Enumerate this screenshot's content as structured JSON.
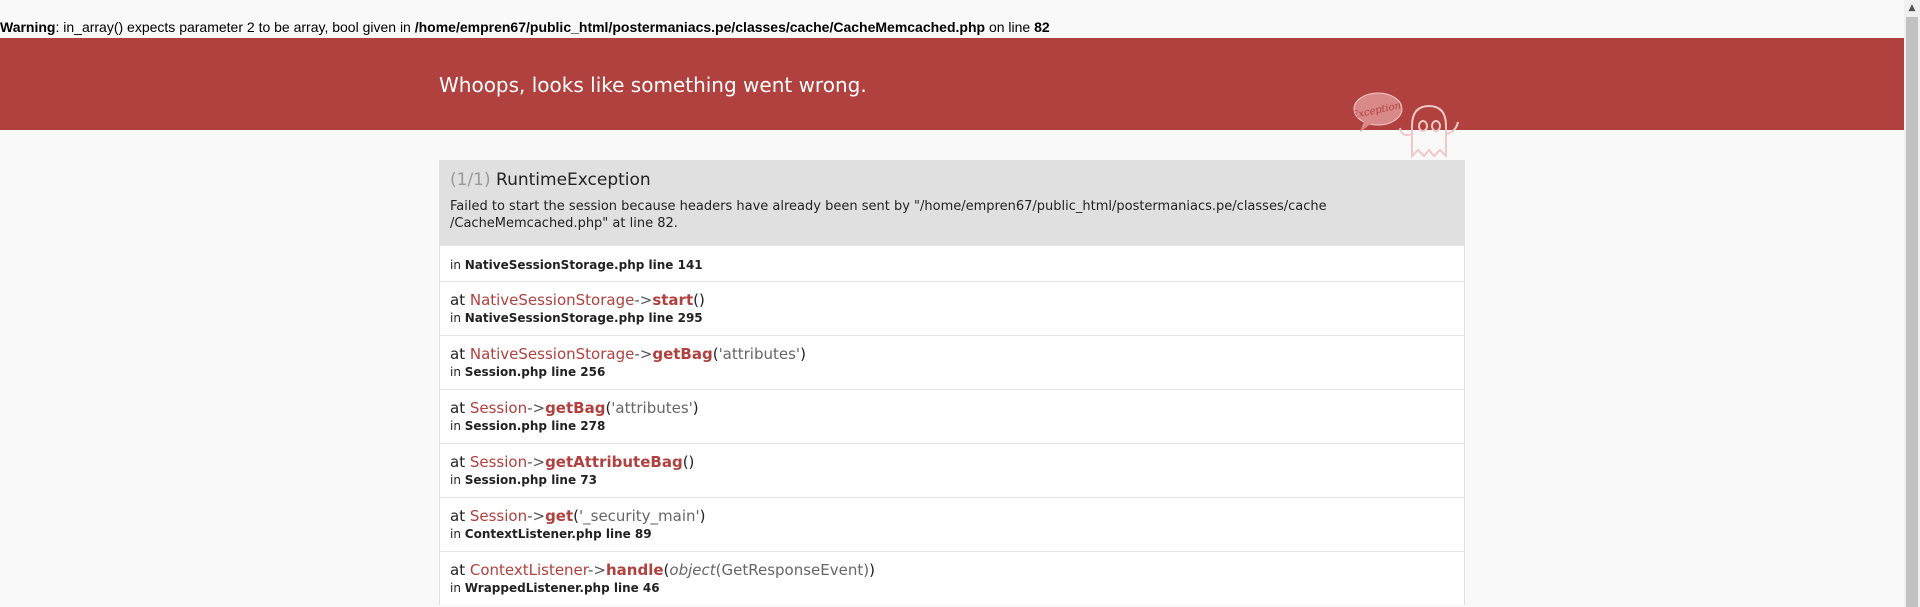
{
  "warning": {
    "label": "Warning",
    "message": ": in_array() expects parameter 2 to be array, bool given in ",
    "file": "/home/empren67/public_html/postermaniacs.pe/classes/cache/CacheMemcached.php",
    "on_line": " on line ",
    "line": "82"
  },
  "header": {
    "title": "Whoops, looks like something went wrong.",
    "bubble_text": "Exception!",
    "color": "#b0413e"
  },
  "exception": {
    "count": "(1/1)",
    "name": "RuntimeException",
    "message": "Failed to start the session because headers have already been sent by \"/home/empren67/public_html/postermaniacs.pe/classes/cache /CacheMemcached.php\" at line 82."
  },
  "trace": {
    "first": {
      "in": "in ",
      "file": "NativeSessionStorage.php line 141"
    },
    "rows": [
      {
        "at": "at ",
        "class": "NativeSessionStorage",
        "arrow": "->",
        "method": "start",
        "open": "(",
        "args": "",
        "close": ")",
        "in": "in ",
        "file": "NativeSessionStorage.php line 295"
      },
      {
        "at": "at ",
        "class": "NativeSessionStorage",
        "arrow": "->",
        "method": "getBag",
        "open": "(",
        "args": "'attributes'",
        "close": ")",
        "in": "in ",
        "file": "Session.php line 256"
      },
      {
        "at": "at ",
        "class": "Session",
        "arrow": "->",
        "method": "getBag",
        "open": "(",
        "args": "'attributes'",
        "close": ")",
        "in": "in ",
        "file": "Session.php line 278"
      },
      {
        "at": "at ",
        "class": "Session",
        "arrow": "->",
        "method": "getAttributeBag",
        "open": "(",
        "args": "",
        "close": ")",
        "in": "in ",
        "file": "Session.php line 73"
      },
      {
        "at": "at ",
        "class": "Session",
        "arrow": "->",
        "method": "get",
        "open": "(",
        "args": "'_security_main'",
        "close": ")",
        "in": "in ",
        "file": "ContextListener.php line 89"
      },
      {
        "at": "at ",
        "class": "ContextListener",
        "arrow": "->",
        "method": "handle",
        "open": "(",
        "args_italic": "object",
        "args": "(GetResponseEvent)",
        "close": ")",
        "in": "in ",
        "file": "WrappedListener.php line 46"
      }
    ]
  },
  "scrollbar": {
    "up_icon": "▲"
  }
}
